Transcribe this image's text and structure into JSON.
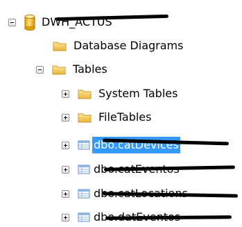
{
  "tree": {
    "database": {
      "label": "DWH_ACTUS",
      "icon": "database-icon"
    },
    "diagrams": {
      "label": "Database Diagrams",
      "icon": "folder-icon"
    },
    "tables": {
      "label": "Tables",
      "icon": "folder-icon"
    },
    "system_tables": {
      "label": "System Tables",
      "icon": "folder-icon"
    },
    "file_tables": {
      "label": "FileTables",
      "icon": "folder-icon"
    },
    "items": [
      {
        "label": "dbo.catDevices",
        "icon": "table-icon",
        "selected": true
      },
      {
        "label": "dbo.catEventos",
        "icon": "table-icon"
      },
      {
        "label": "dbo.catLocations",
        "icon": "table-icon"
      },
      {
        "label": "dbo.datEventos",
        "icon": "table-icon"
      }
    ]
  },
  "colors": {
    "selection": "#3399ff",
    "folder": "#f0c74d",
    "database": "#f2b70c",
    "redaction": "#000000"
  }
}
